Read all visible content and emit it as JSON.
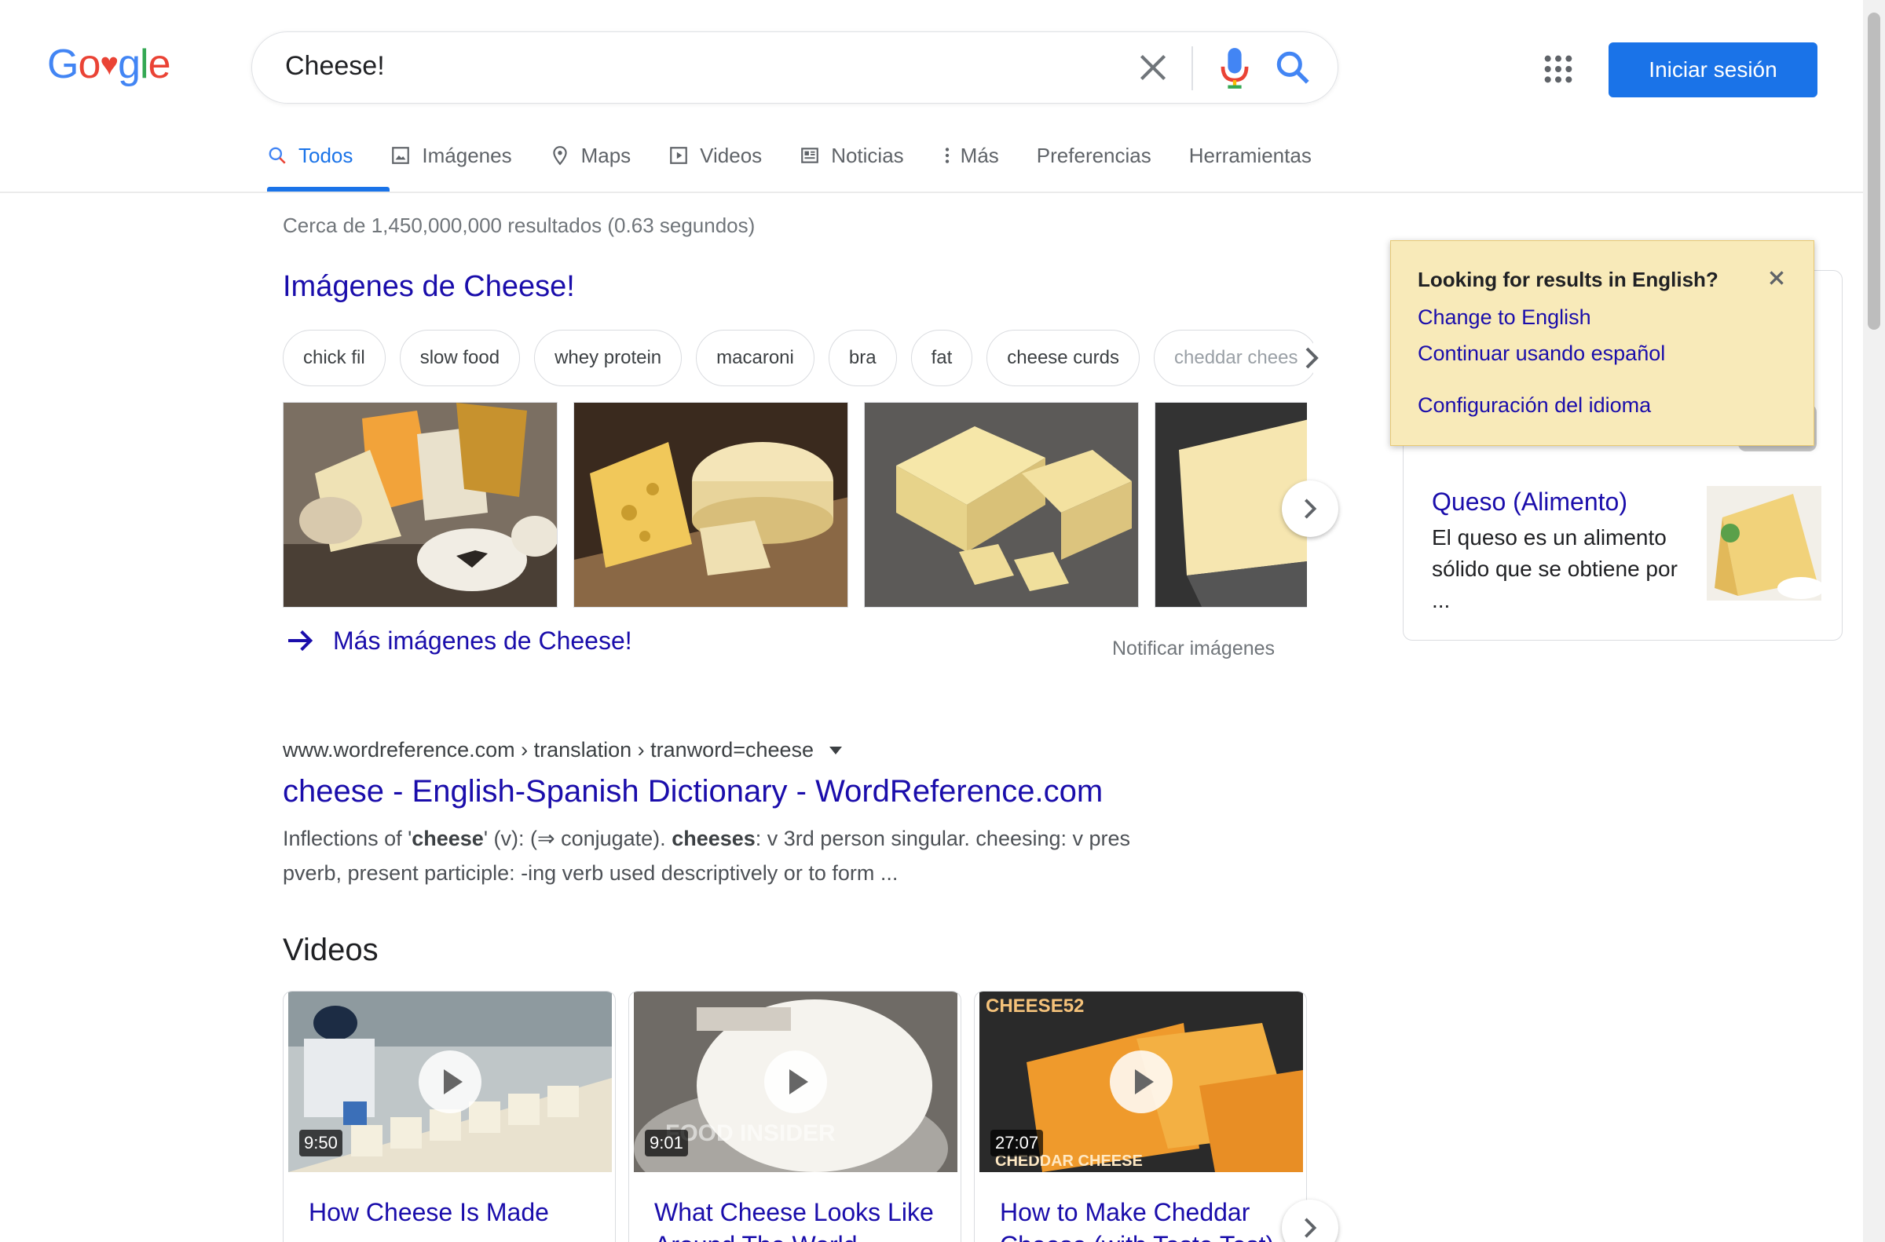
{
  "logo": {
    "letters": [
      "G",
      "o",
      "♥",
      "g",
      "l",
      "e"
    ],
    "colors": [
      "#4285f4",
      "#ea4335",
      "#ea4335",
      "#4285f4",
      "#34a853",
      "#ea4335"
    ]
  },
  "search": {
    "query": "Cheese!"
  },
  "header": {
    "signin_label": "Iniciar sesión"
  },
  "tabs": [
    {
      "label": "Todos",
      "icon": "search-icon"
    },
    {
      "label": "Imágenes",
      "icon": "image-icon"
    },
    {
      "label": "Maps",
      "icon": "map-pin-icon"
    },
    {
      "label": "Videos",
      "icon": "video-icon"
    },
    {
      "label": "Noticias",
      "icon": "news-icon"
    },
    {
      "label": "Más",
      "icon": "more-vert-icon"
    },
    {
      "label": "Preferencias"
    },
    {
      "label": "Herramientas"
    }
  ],
  "stats": "Cerca de 1,450,000,000 resultados (0.63 segundos)",
  "images": {
    "title": "Imágenes de Cheese!",
    "chips": [
      "chick fil",
      "slow food",
      "whey protein",
      "macaroni",
      "bra",
      "fat",
      "cheese curds",
      "cheddar chees"
    ],
    "more_label": "Más imágenes de Cheese!",
    "report_label": "Notificar imágenes"
  },
  "result": {
    "cite": "www.wordreference.com › translation › tranword=cheese",
    "title": "cheese - English-Spanish Dictionary - WordReference.com",
    "snippet": {
      "p1": "Inflections of '",
      "b1": "cheese",
      "p2": "' (v): (⇒ conjugate). ",
      "b2": "cheeses",
      "p3": ": v 3rd person singular. cheesing: v pres pverb, present participle: -ing verb used descriptively or to form ..."
    }
  },
  "videos": {
    "heading": "Videos",
    "items": [
      {
        "duration": "9:50",
        "title": "How Cheese Is Made"
      },
      {
        "duration": "9:01",
        "title": "What Cheese Looks Like Around The World",
        "overlay": "FOOD INSIDER"
      },
      {
        "duration": "27:07",
        "title": "How to Make Cheddar Cheese (with Taste Test)",
        "overlay_top": "CHEESE52",
        "overlay_bottom": "CHEDDAR CHEESE"
      }
    ]
  },
  "knowledge": {
    "title": "Queso (Alimento)",
    "description": "El queso es un alimento sólido que se obtiene por ..."
  },
  "lang_popup": {
    "heading": "Looking for results in English?",
    "change_link": "Change to English",
    "continue_link": "Continuar usando español",
    "settings_link": "Configuración del idioma"
  }
}
